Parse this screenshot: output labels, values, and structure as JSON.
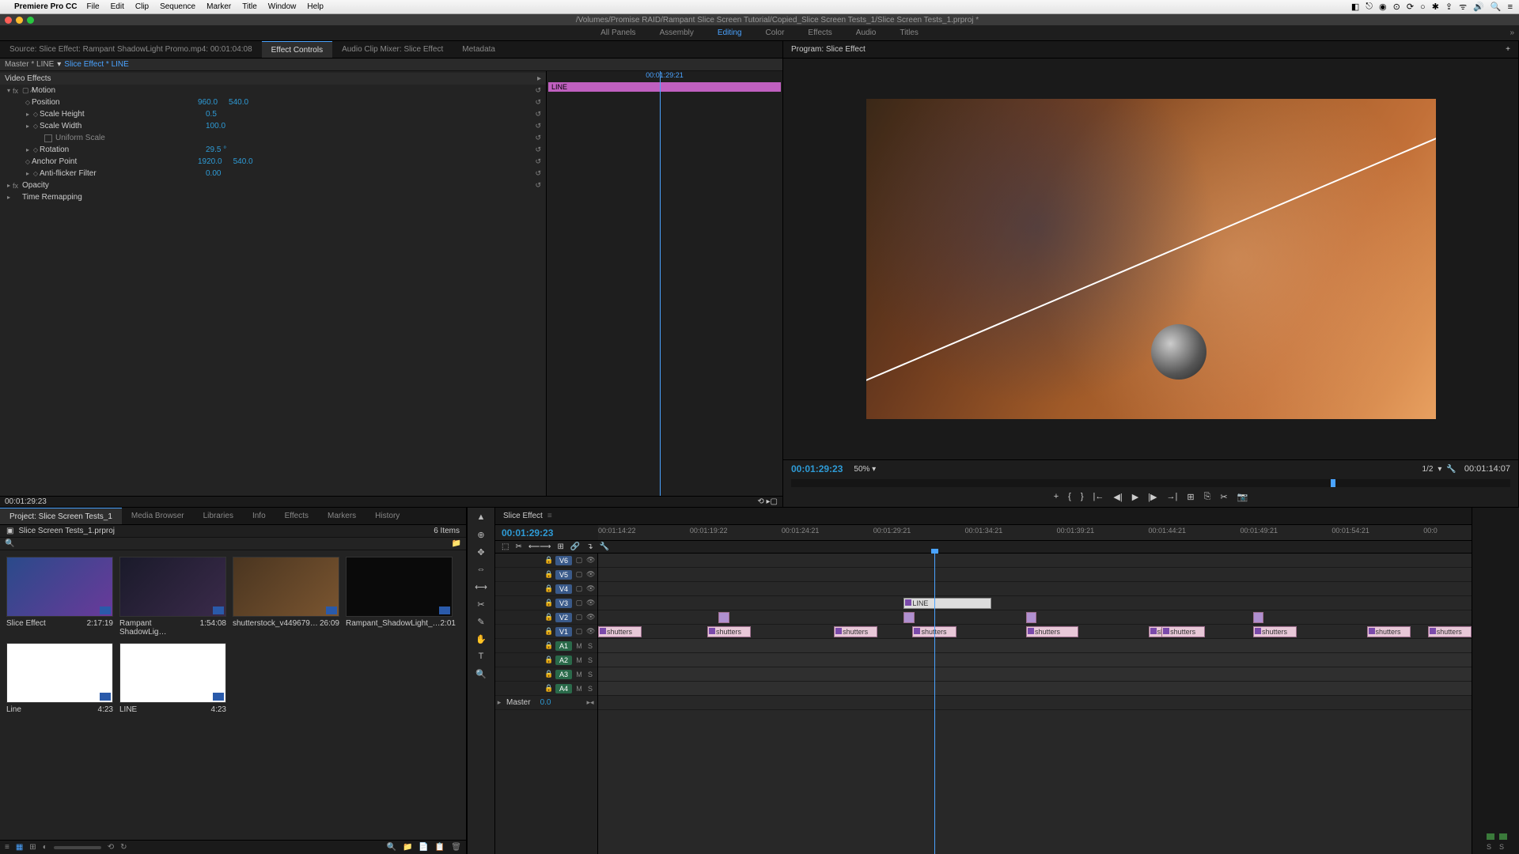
{
  "mac_menu": {
    "app": "Premiere Pro CC",
    "items": [
      "File",
      "Edit",
      "Clip",
      "Sequence",
      "Marker",
      "Title",
      "Window",
      "Help"
    ],
    "status_icons": [
      "◧",
      "⎋",
      "◉",
      "⊙",
      "⟳",
      "○",
      "✱",
      "⇪",
      "ᯤ",
      "🔊",
      "🔍",
      "≡"
    ]
  },
  "window": {
    "path": "/Volumes/Promise RAID/Rampant Slice Screen Tutorial/Copied_Slice Screen Tests_1/Slice Screen Tests_1.prproj *"
  },
  "workspaces": {
    "items": [
      "All Panels",
      "Assembly",
      "Editing",
      "Color",
      "Effects",
      "Audio",
      "Titles"
    ],
    "active": "Editing"
  },
  "source_tabs": {
    "source_label": "Source: Slice Effect: Rampant ShadowLight Promo.mp4: 00:01:04:08",
    "effect_controls": "Effect Controls",
    "audio_mixer": "Audio Clip Mixer: Slice Effect",
    "metadata": "Metadata"
  },
  "ec": {
    "master": "Master * LINE",
    "clip": "Slice Effect * LINE",
    "section_video_effects": "Video Effects",
    "motion": {
      "label": "Motion",
      "position": {
        "label": "Position",
        "x": "960.0",
        "y": "540.0"
      },
      "scale_h": {
        "label": "Scale Height",
        "v": "0.5"
      },
      "scale_w": {
        "label": "Scale Width",
        "v": "100.0"
      },
      "uniform": {
        "label": "Uniform Scale"
      },
      "rotation": {
        "label": "Rotation",
        "v": "29.5 °"
      },
      "anchor": {
        "label": "Anchor Point",
        "x": "1920.0",
        "y": "540.0"
      },
      "antiflicker": {
        "label": "Anti-flicker Filter",
        "v": "0.00"
      }
    },
    "opacity": "Opacity",
    "time_remap": "Time Remapping",
    "mini_tc": "00:01:29:21",
    "mini_clip": "LINE",
    "footer_tc": "00:01:29:23"
  },
  "program": {
    "tab": "Program: Slice Effect",
    "tc_left": "00:01:29:23",
    "zoom": "50%",
    "fit": "1/2",
    "tc_right": "00:01:14:07",
    "buttons": [
      "+",
      "{",
      "}",
      "|←",
      "◀|",
      "▶",
      "|▶",
      "→|",
      "⊞",
      "⎘",
      "✂",
      "📷"
    ]
  },
  "project": {
    "tabs": [
      "Project: Slice Screen Tests_1",
      "Media Browser",
      "Libraries",
      "Info",
      "Effects",
      "Markers",
      "History"
    ],
    "filename": "Slice Screen Tests_1.prproj",
    "count": "6 Items",
    "items": [
      {
        "name": "Slice Effect",
        "dur": "2:17:19",
        "thumb": "seq"
      },
      {
        "name": "Rampant ShadowLig…",
        "dur": "1:54:08",
        "thumb": "vid1"
      },
      {
        "name": "shutterstock_v449679…",
        "dur": "26:09",
        "thumb": "vid2"
      },
      {
        "name": "Rampant_ShadowLight_…",
        "dur": "2:01",
        "thumb": "dark"
      },
      {
        "name": "Line",
        "dur": "4:23",
        "thumb": "white"
      },
      {
        "name": "LINE",
        "dur": "4:23",
        "thumb": "white"
      }
    ],
    "footer_icons": [
      "≡",
      "▦",
      "⊞",
      "◐",
      "",
      "⟲",
      "↻",
      "",
      "🔍",
      "📁",
      "📄",
      "📋",
      "🗑"
    ]
  },
  "timeline": {
    "tab": "Slice Effect",
    "tc": "00:01:29:23",
    "toolbar_icons": [
      "⬚",
      "✂",
      "⟵⟶",
      "⊞",
      "🔗",
      "↴",
      "🔧"
    ],
    "ruler": [
      "00:01:14:22",
      "00:01:19:22",
      "00:01:24:21",
      "00:01:29:21",
      "00:01:34:21",
      "00:01:39:21",
      "00:01:44:21",
      "00:01:49:21",
      "00:01:54:21",
      "00:0"
    ],
    "video_tracks": [
      "V6",
      "V5",
      "V4",
      "V3",
      "V2",
      "V1"
    ],
    "audio_tracks": [
      "A1",
      "A2",
      "A3",
      "A4"
    ],
    "master": {
      "label": "Master",
      "val": "0.0"
    },
    "line_clip": "LINE",
    "shutters": "shutters"
  },
  "tools": [
    "▲",
    "⊕",
    "✥",
    "⇔",
    "⟷",
    "✂",
    "✎",
    "✋",
    "T",
    "🔍"
  ],
  "meters": {
    "s1": "S",
    "s2": "S"
  }
}
